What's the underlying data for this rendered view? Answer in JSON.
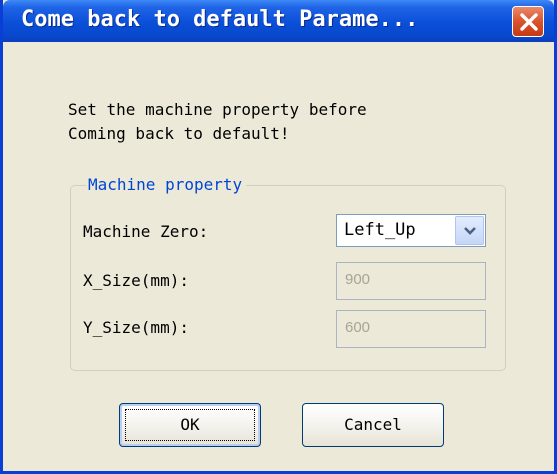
{
  "window": {
    "title": "Come back to default Parame..."
  },
  "message": {
    "line1": "Set the machine property before",
    "line2": "Coming back to default!"
  },
  "group": {
    "legend": "Machine property",
    "machine_zero_label": "Machine Zero:",
    "machine_zero_value": "Left_Up",
    "x_size_label": "X_Size(mm):",
    "x_size_value": "900",
    "y_size_label": "Y_Size(mm):",
    "y_size_value": "600"
  },
  "buttons": {
    "ok_label": "OK",
    "cancel_label": "Cancel"
  },
  "icons": {
    "close": "close-icon",
    "dropdown": "chevron-down-icon"
  },
  "colors": {
    "titlebar": "#0a4fd8",
    "close_button": "#d9532c",
    "legend_text": "#0046d5",
    "dialog_background": "#ece9d8"
  }
}
